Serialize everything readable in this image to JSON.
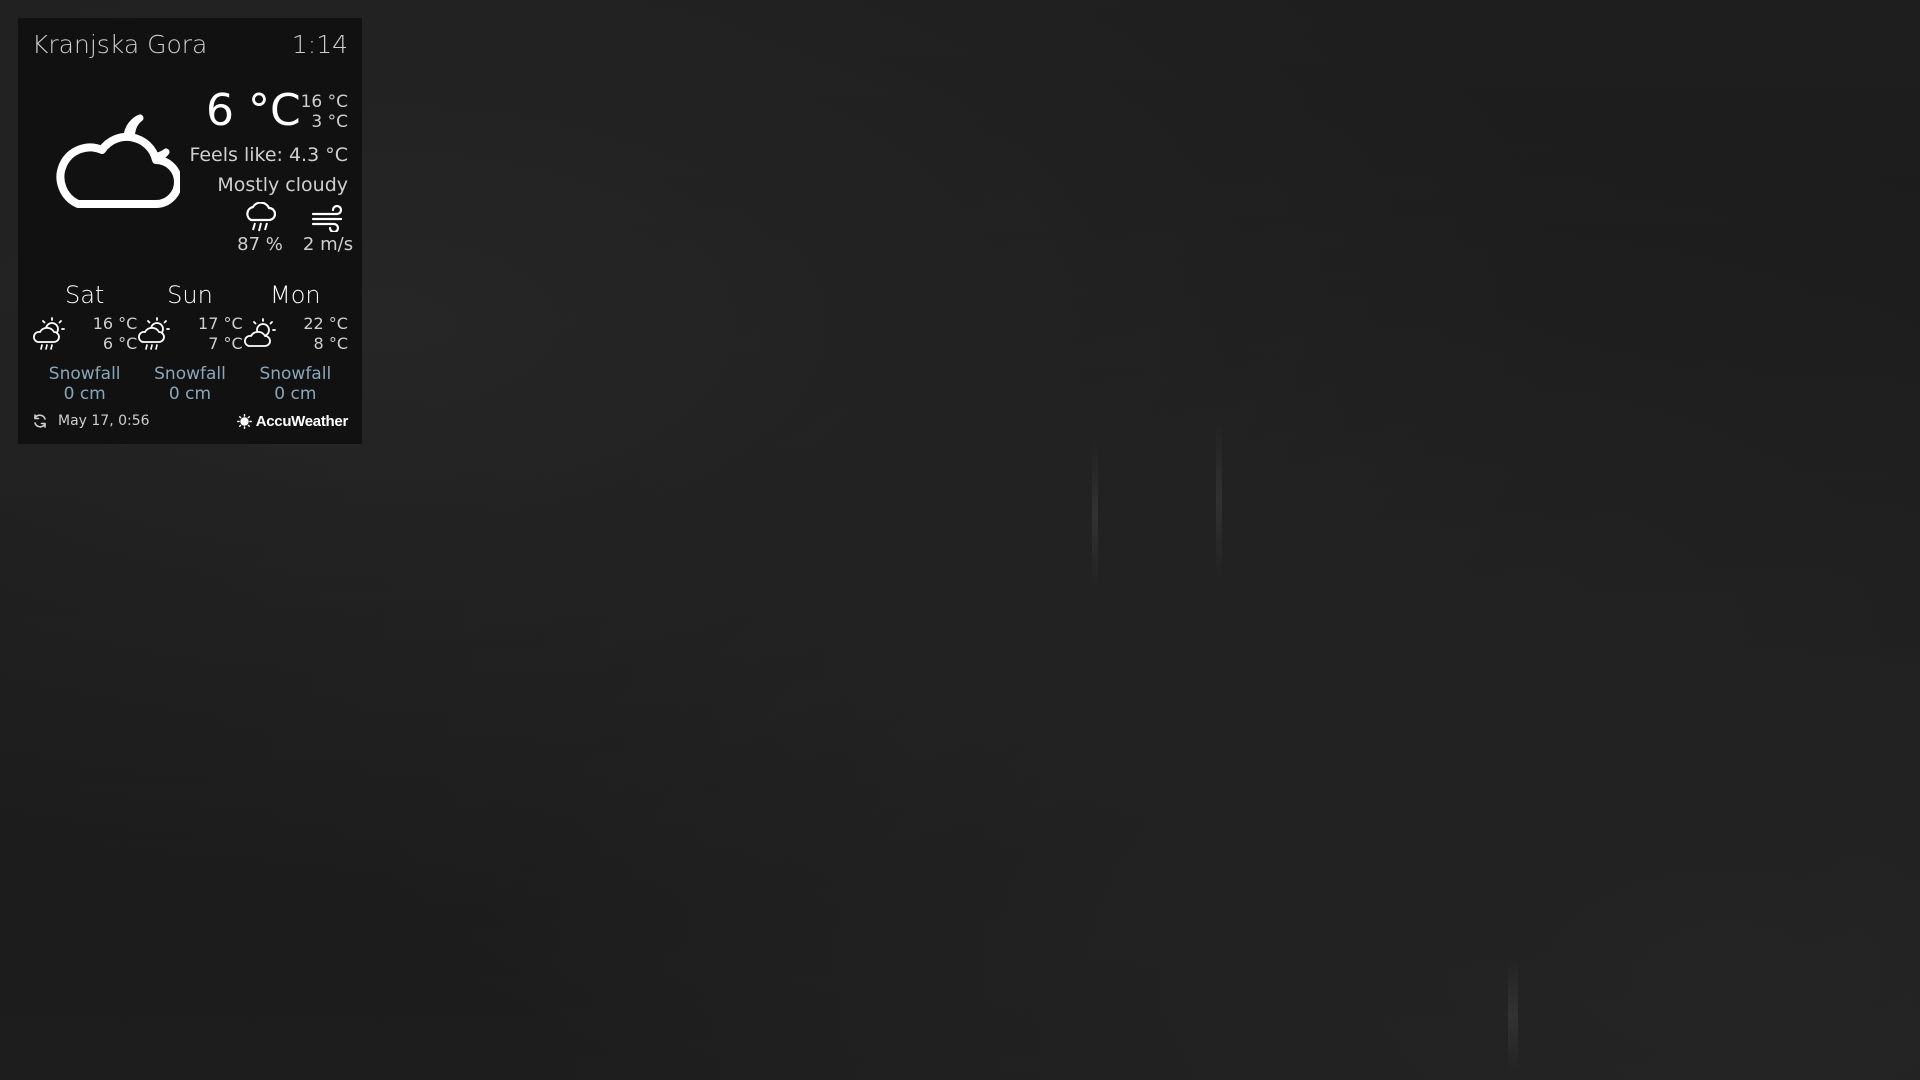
{
  "location": "Kranjska Gora",
  "time": "1:14",
  "current": {
    "temp": "6 °C",
    "high": "16 °C",
    "low": "3 °C",
    "feels_like": "Feels like: 4.3 °C",
    "condition": "Mostly cloudy",
    "icon": "cloud-moon-icon",
    "precip_icon": "rain-cloud-icon",
    "precip": "87 %",
    "wind_icon": "wind-icon",
    "wind": "2 m/s"
  },
  "forecast": [
    {
      "day": "Sat",
      "high": "16 °C",
      "low": "6 °C",
      "icon": "sun-cloud-rain-icon",
      "snow_label": "Snowfall",
      "snow_value": "0 cm"
    },
    {
      "day": "Sun",
      "high": "17 °C",
      "low": "7 °C",
      "icon": "sun-cloud-rain-icon",
      "snow_label": "Snowfall",
      "snow_value": "0 cm"
    },
    {
      "day": "Mon",
      "high": "22 °C",
      "low": "8 °C",
      "icon": "sun-cloud-icon",
      "snow_label": "Snowfall",
      "snow_value": "0 cm"
    }
  ],
  "footer": {
    "updated": "May 17, 0:56",
    "refresh_icon": "refresh-icon",
    "brand": "AccuWeather"
  },
  "colors": {
    "background": "#1c1c1c",
    "panel": "#111111",
    "text": "#ffffff",
    "muted": "#cfcfcf",
    "snow_accent": "#8aa6bb"
  }
}
